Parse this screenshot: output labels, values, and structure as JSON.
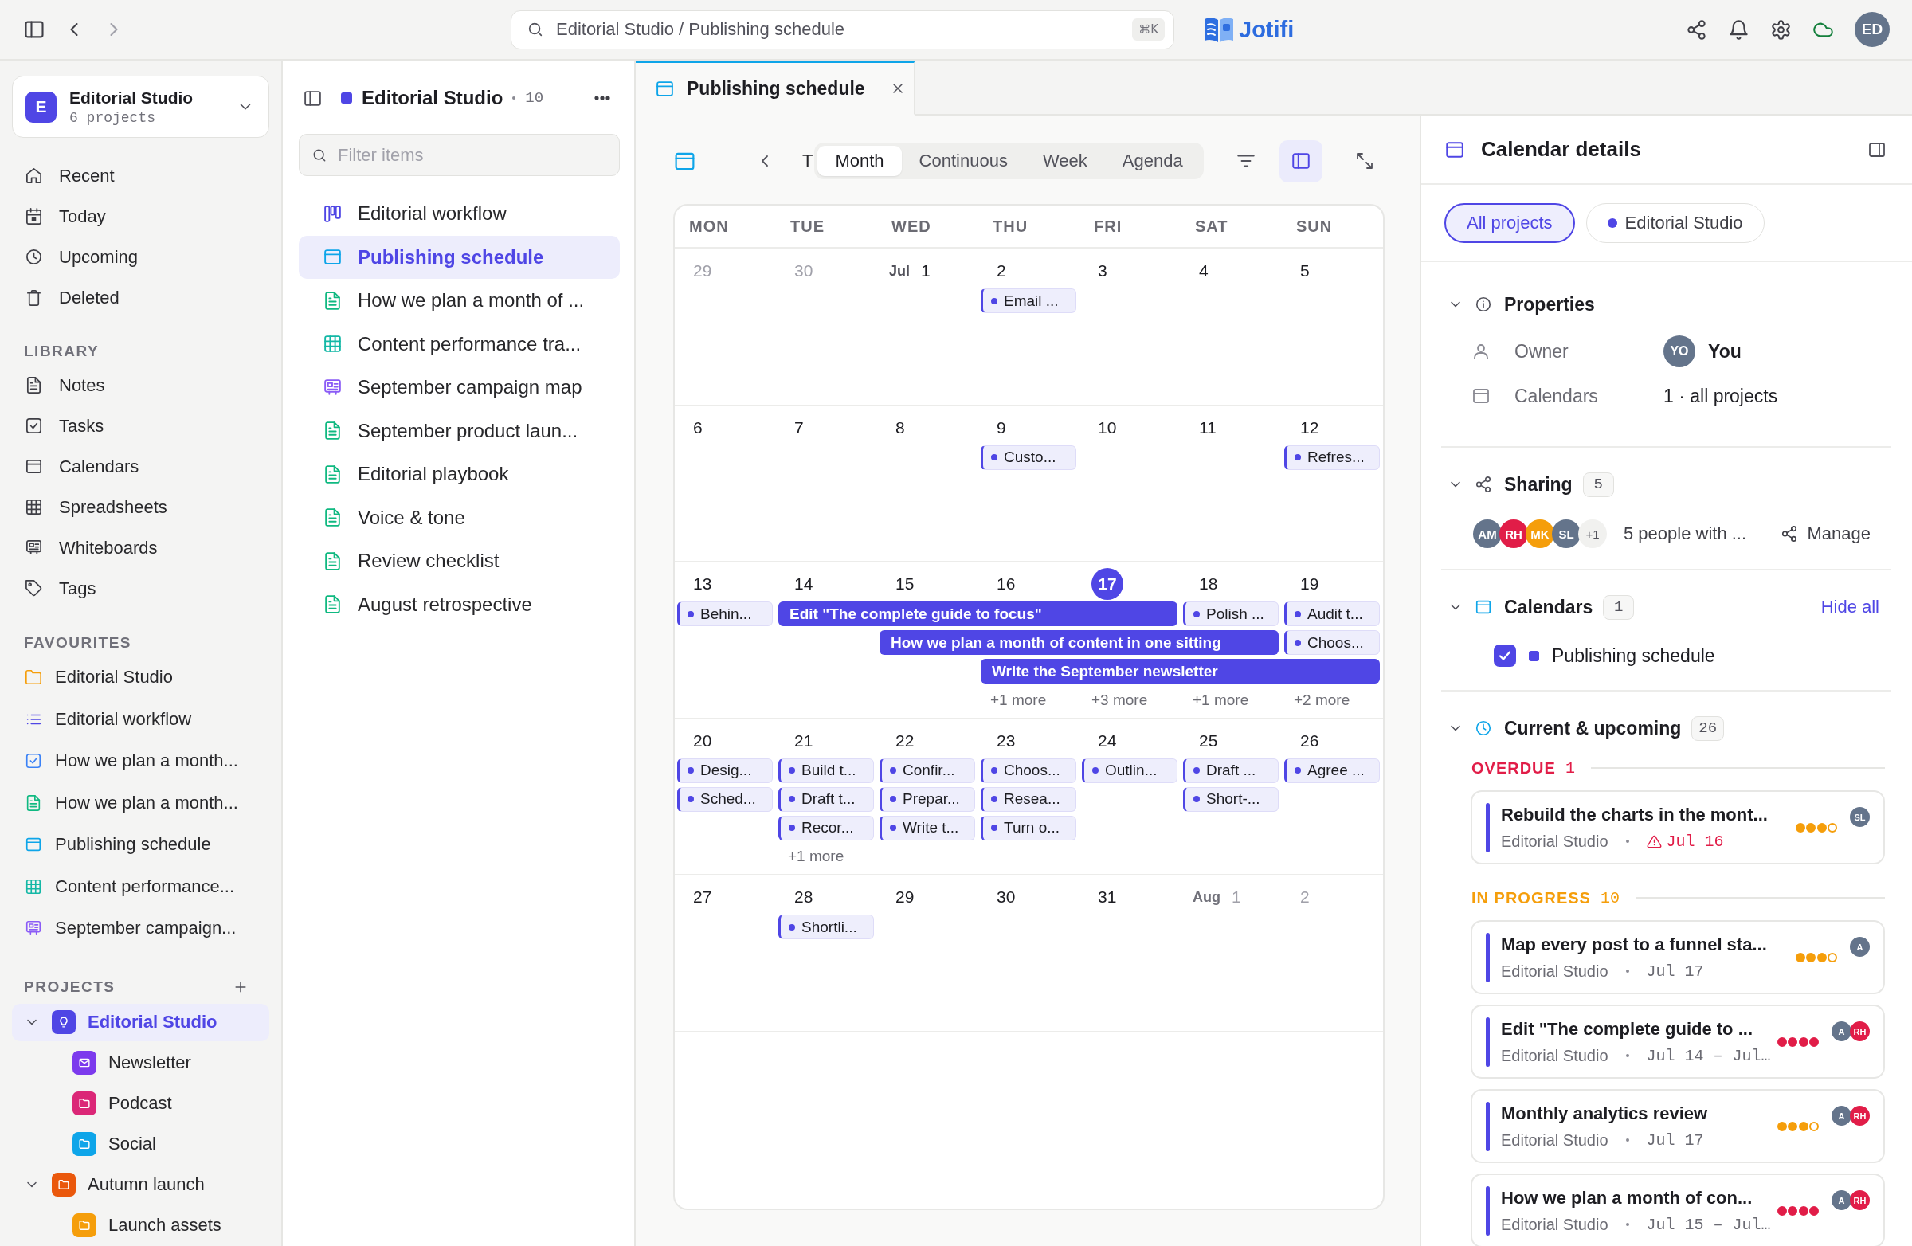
{
  "topbar": {
    "search": {
      "value": "Editorial Studio / Publishing schedule",
      "shortcut": "⌘K"
    },
    "app_name": "Jotifi",
    "user": {
      "initials": "ED"
    }
  },
  "sidebar": {
    "workspace": {
      "initial": "E",
      "name": "Editorial Studio",
      "subtitle": "6 projects"
    },
    "nav": [
      {
        "label": "Recent",
        "kind": "recent",
        "selected": false
      },
      {
        "label": "Today",
        "kind": "today",
        "selected": false
      },
      {
        "label": "Upcoming",
        "kind": "upcoming",
        "selected": false
      },
      {
        "label": "Deleted",
        "kind": "deleted",
        "selected": false
      }
    ],
    "library": {
      "title": "LIBRARY",
      "items": [
        {
          "label": "Notes",
          "kind": "notes",
          "selected": false
        },
        {
          "label": "Tasks",
          "kind": "tasks",
          "selected": false
        },
        {
          "label": "Calendars",
          "kind": "calendars",
          "selected": false
        },
        {
          "label": "Spreadsheets",
          "kind": "spreadsheets",
          "selected": false
        },
        {
          "label": "Whiteboards",
          "kind": "whiteboards",
          "selected": false
        },
        {
          "label": "Tags",
          "kind": "tags",
          "selected": false
        }
      ]
    },
    "favourites": {
      "title": "FAVOURITES",
      "items": [
        {
          "label": "Editorial Studio",
          "kind": "folder",
          "selected": false
        },
        {
          "label": "Editorial workflow",
          "kind": "list",
          "selected": false
        },
        {
          "label": "How we plan a month...",
          "kind": "task",
          "selected": false
        },
        {
          "label": "How we plan a month...",
          "kind": "note",
          "selected": false
        },
        {
          "label": "Publishing schedule",
          "kind": "calendar",
          "selected": false
        },
        {
          "label": "Content performance...",
          "kind": "spreadsheet",
          "selected": false
        },
        {
          "label": "September campaign...",
          "kind": "whiteboard",
          "selected": false
        }
      ]
    },
    "projects": {
      "title": "PROJECTS",
      "items": [
        {
          "label": "Editorial Studio",
          "kind": "idea",
          "color": "#4f46e5",
          "selected": true,
          "expanded": true,
          "children": [
            {
              "label": "Newsletter",
              "kind": "mail",
              "color": "#7c3aed",
              "selected": false
            },
            {
              "label": "Podcast",
              "kind": "folder",
              "color": "#db2777",
              "selected": false
            },
            {
              "label": "Social",
              "kind": "folder",
              "color": "#0ea5e9",
              "selected": false
            }
          ]
        },
        {
          "label": "Autumn launch",
          "kind": "folder",
          "color": "#ea580c",
          "selected": false,
          "expanded": true,
          "children": [
            {
              "label": "Launch assets",
              "kind": "folder",
              "color": "#f59e0b",
              "selected": false
            }
          ]
        }
      ]
    }
  },
  "collection": {
    "title": "Editorial Studio",
    "count": "10",
    "filter": {
      "placeholder": "Filter items"
    },
    "items": [
      {
        "label": "Editorial workflow",
        "kind": "board",
        "selected": false
      },
      {
        "label": "Publishing schedule",
        "kind": "calendar",
        "selected": true
      },
      {
        "label": "How we plan a month of ...",
        "kind": "note",
        "selected": false
      },
      {
        "label": "Content performance tra...",
        "kind": "spreadsheet",
        "selected": false
      },
      {
        "label": "September campaign map",
        "kind": "whiteboard",
        "selected": false
      },
      {
        "label": "September product laun...",
        "kind": "note",
        "selected": false
      },
      {
        "label": "Editorial playbook",
        "kind": "note",
        "selected": false
      },
      {
        "label": "Voice & tone",
        "kind": "note",
        "selected": false
      },
      {
        "label": "Review checklist",
        "kind": "note",
        "selected": false
      },
      {
        "label": "August retrospective",
        "kind": "note",
        "selected": false
      }
    ]
  },
  "tabs": [
    {
      "title": "Publishing schedule",
      "kind": "calendar",
      "selected": true
    }
  ],
  "toolbar": {
    "today_label": "T",
    "views": [
      {
        "label": "Month",
        "selected": true
      },
      {
        "label": "Continuous",
        "selected": false
      },
      {
        "label": "Week",
        "selected": false
      },
      {
        "label": "Agenda",
        "selected": false
      }
    ],
    "details_panel": {
      "on": true
    }
  },
  "calendar": {
    "weekdays": [
      "MON",
      "TUE",
      "WED",
      "THU",
      "FRI",
      "SAT",
      "SUN"
    ],
    "weeks": [
      {
        "days": [
          {
            "label": "29",
            "muted": true,
            "today": false
          },
          {
            "label": "30",
            "muted": true,
            "today": false
          },
          {
            "month": "Jul",
            "label": "1",
            "muted": false,
            "today": false
          },
          {
            "label": "2",
            "muted": false,
            "today": false,
            "events": [
              {
                "kind": "chip",
                "title": "Email ..."
              }
            ]
          },
          {
            "label": "3",
            "muted": false,
            "today": false
          },
          {
            "label": "4",
            "muted": false,
            "today": false
          },
          {
            "label": "5",
            "muted": false,
            "today": false
          }
        ]
      },
      {
        "days": [
          {
            "label": "6",
            "muted": false,
            "today": false
          },
          {
            "label": "7",
            "muted": false,
            "today": false
          },
          {
            "label": "8",
            "muted": false,
            "today": false
          },
          {
            "label": "9",
            "muted": false,
            "today": false,
            "events": [
              {
                "kind": "chip",
                "title": "Custo..."
              }
            ]
          },
          {
            "label": "10",
            "muted": false,
            "today": false
          },
          {
            "label": "11",
            "muted": false,
            "today": false
          },
          {
            "label": "12",
            "muted": false,
            "today": false,
            "events": [
              {
                "kind": "chip",
                "title": "Refres..."
              }
            ]
          }
        ]
      },
      {
        "days": [
          {
            "label": "13",
            "muted": false,
            "today": false,
            "events": [
              {
                "kind": "chip",
                "title": "Behin..."
              }
            ]
          },
          {
            "label": "14",
            "muted": false,
            "today": false,
            "events": [
              {
                "kind": "bar",
                "title": "Edit \"The complete guide to focus\""
              }
            ]
          },
          {
            "label": "15",
            "muted": false,
            "today": false,
            "events": [
              {
                "kind": "continued"
              },
              {
                "kind": "bar",
                "title": "How we plan a month of content in one sitting"
              }
            ]
          },
          {
            "label": "16",
            "muted": false,
            "today": false,
            "events": [
              {
                "kind": "continued"
              },
              {
                "kind": "continued"
              },
              {
                "kind": "bar",
                "title": "Write the September newsletter"
              }
            ],
            "more": "+1 more"
          },
          {
            "label": "17",
            "muted": false,
            "today": true,
            "events": [
              {
                "kind": "continued"
              },
              {
                "kind": "continued"
              },
              {
                "kind": "continued"
              }
            ],
            "more": "+3 more"
          },
          {
            "label": "18",
            "muted": false,
            "today": false,
            "events": [
              {
                "kind": "chip",
                "title": "Polish ..."
              },
              {
                "kind": "continued"
              },
              {
                "kind": "continued"
              }
            ],
            "more": "+1 more"
          },
          {
            "label": "19",
            "muted": false,
            "today": false,
            "events": [
              {
                "kind": "chip",
                "title": "Audit t..."
              },
              {
                "kind": "chip",
                "title": "Choos..."
              },
              {
                "kind": "continued"
              }
            ],
            "more": "+2 more"
          }
        ]
      },
      {
        "days": [
          {
            "label": "20",
            "muted": false,
            "today": false,
            "events": [
              {
                "kind": "chip",
                "title": "Desig..."
              },
              {
                "kind": "chip",
                "title": "Sched..."
              }
            ]
          },
          {
            "label": "21",
            "muted": false,
            "today": false,
            "events": [
              {
                "kind": "chip",
                "title": "Build t..."
              },
              {
                "kind": "chip",
                "title": "Draft t..."
              },
              {
                "kind": "chip",
                "title": "Recor..."
              }
            ],
            "more": "+1 more"
          },
          {
            "label": "22",
            "muted": false,
            "today": false,
            "events": [
              {
                "kind": "chip",
                "title": "Confir..."
              },
              {
                "kind": "chip",
                "title": "Prepar..."
              },
              {
                "kind": "chip",
                "title": "Write t..."
              }
            ]
          },
          {
            "label": "23",
            "muted": false,
            "today": false,
            "events": [
              {
                "kind": "chip",
                "title": "Choos..."
              },
              {
                "kind": "chip",
                "title": "Resea..."
              },
              {
                "kind": "chip",
                "title": "Turn o..."
              }
            ]
          },
          {
            "label": "24",
            "muted": false,
            "today": false,
            "events": [
              {
                "kind": "chip",
                "title": "Outlin..."
              }
            ]
          },
          {
            "label": "25",
            "muted": false,
            "today": false,
            "events": [
              {
                "kind": "chip",
                "title": "Draft ..."
              },
              {
                "kind": "chip",
                "title": "Short-..."
              }
            ]
          },
          {
            "label": "26",
            "muted": false,
            "today": false,
            "events": [
              {
                "kind": "chip",
                "title": "Agree ..."
              }
            ]
          }
        ]
      },
      {
        "days": [
          {
            "label": "27",
            "muted": false,
            "today": false
          },
          {
            "label": "28",
            "muted": false,
            "today": false,
            "events": [
              {
                "kind": "chip",
                "title": "Shortli..."
              }
            ]
          },
          {
            "label": "29",
            "muted": false,
            "today": false
          },
          {
            "label": "30",
            "muted": false,
            "today": false
          },
          {
            "label": "31",
            "muted": false,
            "today": false
          },
          {
            "month": "Aug",
            "label": "1",
            "muted": true,
            "today": false
          },
          {
            "label": "2",
            "muted": true,
            "today": false
          }
        ]
      }
    ]
  },
  "details": {
    "title": "Calendar details",
    "scopes": [
      {
        "label": "All projects",
        "kind": "all",
        "selected": true
      },
      {
        "label": "Editorial Studio",
        "kind": "project",
        "selected": false
      }
    ],
    "properties": {
      "title": "Properties",
      "expanded": true,
      "rows": [
        {
          "label": "Owner",
          "kind": "owner",
          "avatar": "YO",
          "value": "You"
        },
        {
          "label": "Calendars",
          "kind": "calendars",
          "value": "1 · all projects"
        }
      ]
    },
    "sharing": {
      "title": "Sharing",
      "expanded": true,
      "count": "5",
      "avatars": [
        {
          "initials": "AM",
          "color": "#64748b"
        },
        {
          "initials": "RH",
          "color": "#e11d48"
        },
        {
          "initials": "MK",
          "color": "#f59e0b"
        },
        {
          "initials": "SL",
          "color": "#64748b"
        }
      ],
      "overflow": "+1",
      "summary": "5 people with ...",
      "action": "Manage"
    },
    "calendars": {
      "title": "Calendars",
      "expanded": true,
      "count": "1",
      "action": "Hide all",
      "items": [
        {
          "label": "Publishing schedule",
          "checked": true
        }
      ]
    },
    "upcoming": {
      "title": "Current & upcoming",
      "expanded": true,
      "count": "26",
      "groups": [
        {
          "kind": "overdue",
          "label": "OVERDUE",
          "count": "1",
          "cards": [
            {
              "title": "Rebuild the charts in the mont...",
              "project": "Editorial Studio",
              "date": "Jul 16",
              "overdue": true,
              "stars": 3,
              "assignees": [
                {
                  "initials": "SL",
                  "color": "#64748b"
                }
              ]
            }
          ]
        },
        {
          "kind": "in_progress",
          "label": "IN PROGRESS",
          "count": "10",
          "cards": [
            {
              "title": "Map every post to a funnel sta...",
              "project": "Editorial Studio",
              "date": "Jul 17",
              "overdue": false,
              "stars": 3,
              "assignees": [
                {
                  "initials": "A",
                  "color": "#64748b"
                }
              ]
            },
            {
              "title": "Edit \"The complete guide to ...",
              "project": "Editorial Studio",
              "date": "Jul 14 – Jul…",
              "overdue": false,
              "stars": 4,
              "assignees": [
                {
                  "initials": "A",
                  "color": "#64748b"
                },
                {
                  "initials": "RH",
                  "color": "#e11d48"
                }
              ]
            },
            {
              "title": "Monthly analytics review",
              "project": "Editorial Studio",
              "date": "Jul 17",
              "overdue": false,
              "stars": 3,
              "assignees": [
                {
                  "initials": "A",
                  "color": "#64748b"
                },
                {
                  "initials": "RH",
                  "color": "#e11d48"
                }
              ]
            },
            {
              "title": "How we plan a month of con...",
              "project": "Editorial Studio",
              "date": "Jul 15 – Jul…",
              "overdue": false,
              "stars": 4,
              "assignees": [
                {
                  "initials": "A",
                  "color": "#64748b"
                },
                {
                  "initials": "RH",
                  "color": "#e11d48"
                }
              ]
            }
          ]
        }
      ]
    }
  }
}
